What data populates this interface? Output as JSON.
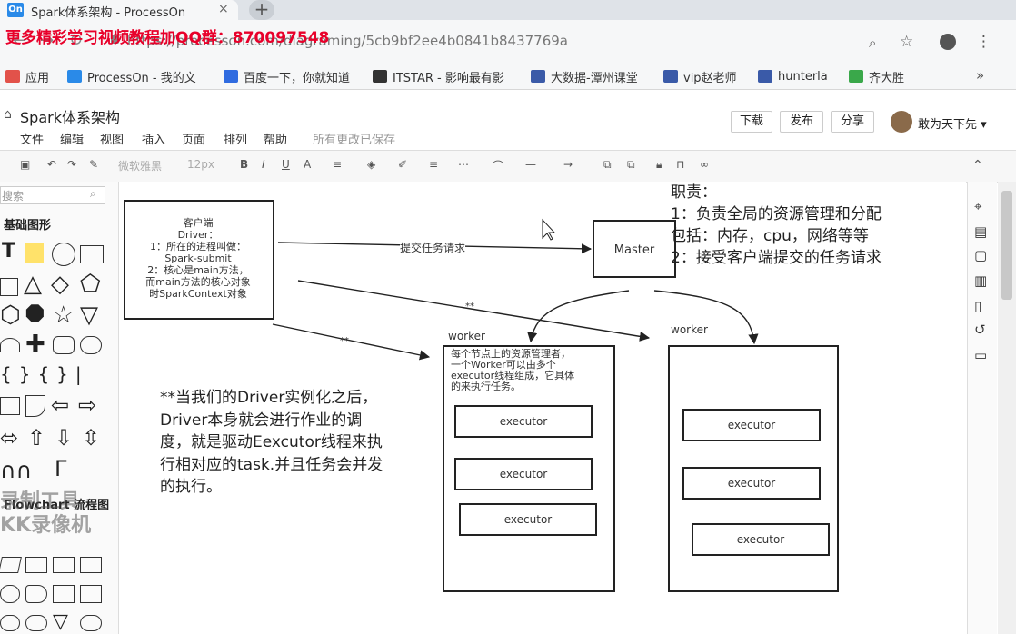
{
  "browser": {
    "tab_favicon": "On",
    "tab_title": "Spark体系架构 - ProcessOn",
    "tab_close": "×",
    "new_tab": "+",
    "promo_overlay": "更多精彩学习视频教程加QQ群：870097548",
    "url": "https://processon.com/diagraming/5cb9bf2ee4b0841b8437769a",
    "bookmarks": [
      {
        "icon": "apps-icon",
        "label": "应用",
        "color": "#e2524a"
      },
      {
        "icon": "processon-icon",
        "label": "ProcessOn - 我的文",
        "color": "#2a8ae8"
      },
      {
        "icon": "baidu-paw-icon",
        "label": "百度一下，你就知道",
        "color": "#2f6be0"
      },
      {
        "icon": "itstar-icon",
        "label": "ITSTAR - 影响最有影",
        "color": "#333333"
      },
      {
        "icon": "course-icon",
        "label": "大数据-潭州课堂",
        "color": "#3a5aa8"
      },
      {
        "icon": "course-icon",
        "label": "vip赵老师",
        "color": "#3a5aa8"
      },
      {
        "icon": "course-icon",
        "label": "hunterla",
        "color": "#3a5aa8"
      },
      {
        "icon": "grid-icon",
        "label": "齐大胜",
        "color": "#3aa84a"
      }
    ],
    "more_bookmarks": "»"
  },
  "app": {
    "doc_title": "Spark体系架构",
    "menus": [
      "文件",
      "编辑",
      "视图",
      "插入",
      "页面",
      "排列",
      "帮助"
    ],
    "saved_status": "所有更改已保存",
    "buttons": {
      "download": "下载",
      "publish": "发布",
      "share": "分享"
    },
    "user_name": "敢为天下先 ▾",
    "toolbar": {
      "font": "微软雅黑",
      "size": "12px",
      "bold": "B",
      "italic": "I",
      "underline": "U",
      "color": "A"
    }
  },
  "left_panel": {
    "search_placeholder": "搜索",
    "basic_shapes_title": "基础图形",
    "flowchart_title": "Flowchart 流程图",
    "watermark": "录制工具\nKK录像机"
  },
  "diagram": {
    "client_box": "客户端\nDriver：\n1：所在的进程叫做：\nSpark-submit\n2：核心是main方法，\n而main方法的核心对象\n时SparkContext对象",
    "master_label": "Master",
    "edge_label_submit": "提交任务请求",
    "edge_label_a": "**",
    "edge_label_b": "**",
    "duty_text": "职责：\n1：负责全局的资源管理和分配\n包括：内存，cpu，网络等等\n2：接受客户端提交的任务请求",
    "worker1_label": "worker",
    "worker2_label": "worker",
    "worker1_desc": "每个节点上的资源管理者，\n一个Worker可以由多个\nexecutor线程组成，它具体\n的来执行任务。",
    "executor_label": "executor",
    "note_text": "**当我们的Driver实例化之后，Driver本身就会进行作业的调度，就是驱动Eexcutor线程来执行相对应的task.并且任务会并发的执行。"
  }
}
